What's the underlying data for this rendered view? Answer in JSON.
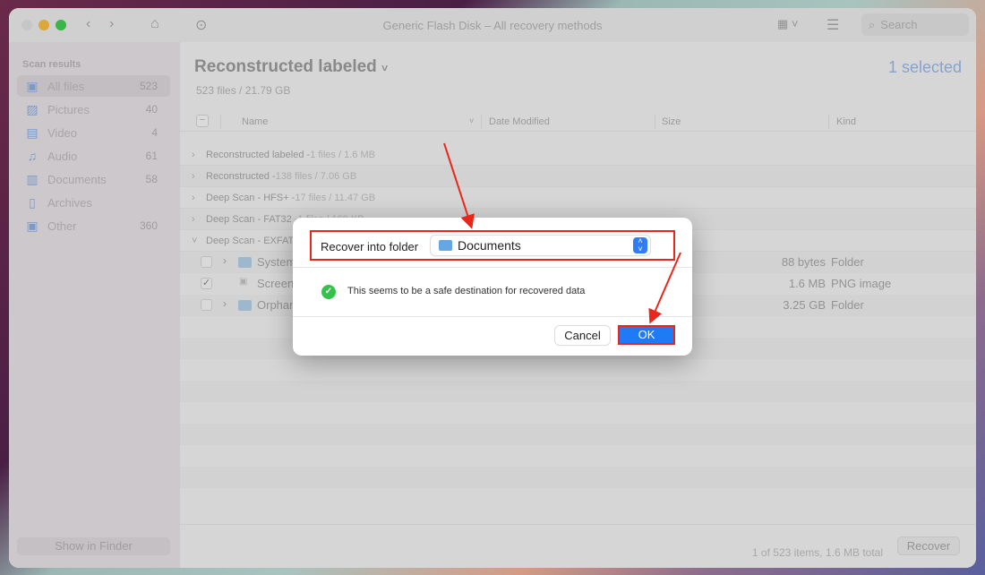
{
  "window": {
    "title": "Generic Flash Disk – All recovery methods",
    "search_placeholder": "Search"
  },
  "sidebar": {
    "heading": "Scan results",
    "items": [
      {
        "label": "All files",
        "count": "523",
        "icon": "all-files-icon"
      },
      {
        "label": "Pictures",
        "count": "40",
        "icon": "pictures-icon"
      },
      {
        "label": "Video",
        "count": "4",
        "icon": "video-icon"
      },
      {
        "label": "Audio",
        "count": "61",
        "icon": "audio-icon"
      },
      {
        "label": "Documents",
        "count": "58",
        "icon": "documents-icon"
      },
      {
        "label": "Archives",
        "count": "",
        "icon": "archives-icon"
      },
      {
        "label": "Other",
        "count": "360",
        "icon": "other-icon"
      }
    ],
    "show_in_finder": "Show in Finder"
  },
  "header": {
    "title": "Reconstructed labeled",
    "subtitle": "523 files / 21.79 GB",
    "selected": "1 selected"
  },
  "columns": {
    "name": "Name",
    "date": "Date Modified",
    "size": "Size",
    "kind": "Kind"
  },
  "groups": [
    {
      "name": "Reconstructed labeled - ",
      "meta": "1 files / 1.6 MB"
    },
    {
      "name": "Reconstructed - ",
      "meta": "138 files / 7.06 GB"
    },
    {
      "name": "Deep Scan - HFS+ - ",
      "meta": "17 files / 11.47 GB"
    },
    {
      "name": "Deep Scan - FAT32 - ",
      "meta": "1 files / 169 KB"
    },
    {
      "name": "Deep Scan - EXFAT",
      "meta": ""
    }
  ],
  "files": [
    {
      "name": "System",
      "size": "88 bytes",
      "kind": "Folder",
      "checked": false
    },
    {
      "name": "Screen",
      "size": "1.6 MB",
      "kind": "PNG image",
      "checked": true
    },
    {
      "name": "Orphan",
      "size": "3.25 GB",
      "kind": "Folder",
      "checked": false
    }
  ],
  "footer": {
    "status": "1 of 523 items, 1.6 MB total",
    "recover": "Recover"
  },
  "dialog": {
    "label": "Recover into folder",
    "folder": "Documents",
    "message": "This seems to be a safe destination for recovered data",
    "cancel": "Cancel",
    "ok": "OK"
  }
}
